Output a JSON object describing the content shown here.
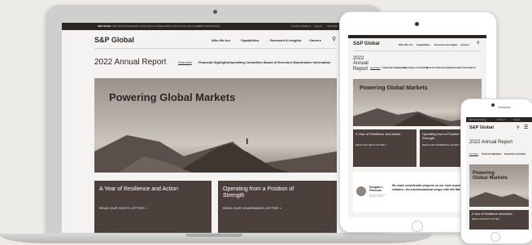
{
  "laptop": {
    "topbar_links": [
      "S&P Global",
      "S&P Global Ratings",
      "S&P Global Market Intelligence",
      "S&P Global Commodity Insights",
      "S&P Global Mobility"
    ],
    "topbar_right": [
      "Investor Relations",
      "Support",
      "Subscribe"
    ],
    "brand": "S&P Global",
    "nav": [
      "Who We Are",
      "Capabilities",
      "Research & Insights",
      "Careers"
    ],
    "report_title": "2022 Annual Report",
    "subnav": [
      "Overview",
      "Financial Highlights",
      "Operating Committee",
      "Board of Directors",
      "Shareholder Information"
    ],
    "hero_title": "Powering Global Markets",
    "card1_title": "A Year of Resilience and Action",
    "card1_link": "READ OUR CEO'S LETTER >",
    "card2_title": "Operating from a Position of Strength",
    "card2_link": "READ OUR CHAIRMAN'S LETTER >"
  },
  "tablet": {
    "brand": "S&P Global",
    "nav": [
      "Who We Are",
      "Capabilities",
      "Research & Insights",
      "Careers"
    ],
    "report_title": "2022 Annual Report",
    "subnav": [
      "Overview",
      "Financial Highlights",
      "Operating Committee",
      "Board of Directors",
      "Shareholder Information"
    ],
    "hero_title": "Powering Global Markets",
    "card1_title": "A Year of Resilience and Action",
    "card1_link": "READ OUR CEO'S LETTER >",
    "card2_title": "Operating from a Position of Strength",
    "card2_link": "READ OUR CHAIRMAN'S LETTER >",
    "quote_name": "Douglas L. Peterson",
    "quote_role": "President and Chief Executive Officer",
    "quote_text": "We made considerable progress on our most important strategic initiative—the transformational merger with IHS Markit."
  },
  "phone": {
    "topbar": [
      "S&P Global Ratings",
      "Products",
      "Support"
    ],
    "brand": "S&P Global",
    "report_title": "2022 Annual Report",
    "subnav": [
      "Overview",
      "Financial Highlights",
      "Operating Committee"
    ],
    "hero_title": "Powering Global Markets",
    "card_title": "A Year of Resilience and Action",
    "card_link": "READ OUR CEO'S LETTER >"
  },
  "colors": {
    "dark": "#2b2624",
    "card": "#4b403b",
    "bg": "#ecebe7"
  }
}
